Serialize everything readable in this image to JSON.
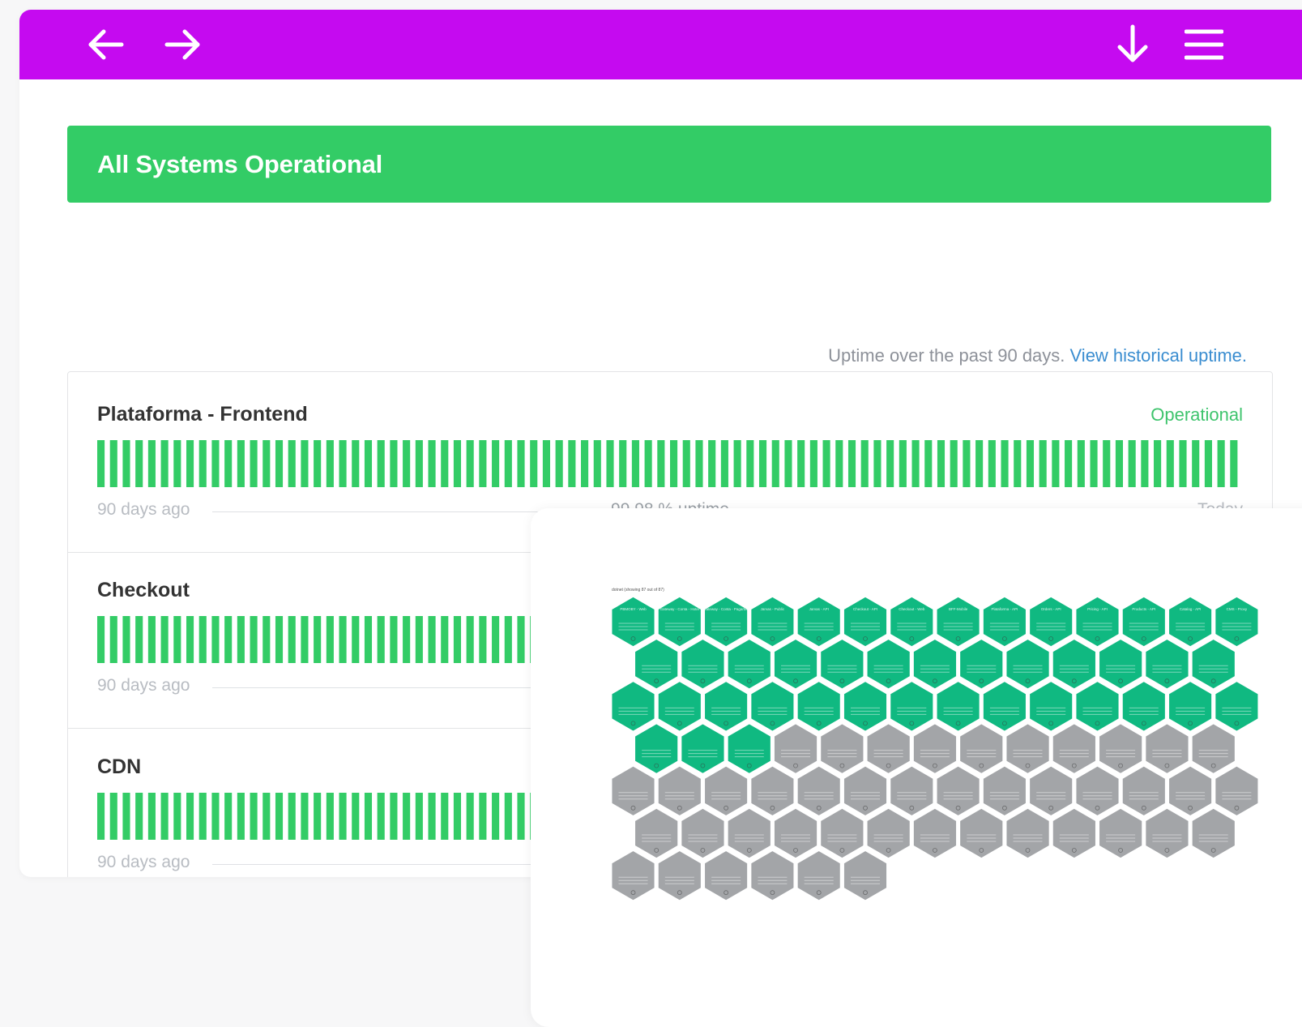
{
  "nav": {
    "back_icon": "arrow-left-icon",
    "forward_icon": "arrow-right-icon",
    "download_icon": "arrow-down-icon",
    "menu_icon": "hamburger-menu-icon",
    "bar_color": "#c50af0"
  },
  "status_banner": {
    "text": "All Systems Operational",
    "color": "#33cc66"
  },
  "uptime_caption": {
    "text": "Uptime over the past 90 days.",
    "link": "View historical uptime."
  },
  "components": [
    {
      "name": "Plataforma - Frontend",
      "status": "Operational",
      "left_label": "90 days ago",
      "uptime": "99.98 % uptime",
      "right_label": "Today"
    },
    {
      "name": "Checkout",
      "status": "",
      "left_label": "90 days ago",
      "uptime": "",
      "right_label": ""
    },
    {
      "name": "CDN",
      "status": "",
      "left_label": "90 days ago",
      "uptime": "",
      "right_label": ""
    }
  ],
  "bar_color": "#33cc66",
  "days_shown": 90,
  "honeycomb": {
    "title": "dotnet (showing 87 out of 87)",
    "healthy_color": "#10b981",
    "unknown_color": "#a3a5a8",
    "healthy_count": 44,
    "total_count": 89,
    "row_lengths": [
      14,
      13,
      14,
      13,
      14,
      13,
      6
    ],
    "first_labels": [
      "PBMOBY - Web",
      "Gateway - Conta - Hotel",
      "Gateway - Conta - PagarMe",
      "Jarvas - Public",
      "Jarvas - API",
      "Checkout - API",
      "Checkout - Web",
      "BFF-Mobile",
      "Plataforma - API",
      "Orders - API",
      "Pricing - API",
      "Products - API",
      "Catalog - API",
      "CMS - Proxy"
    ]
  }
}
